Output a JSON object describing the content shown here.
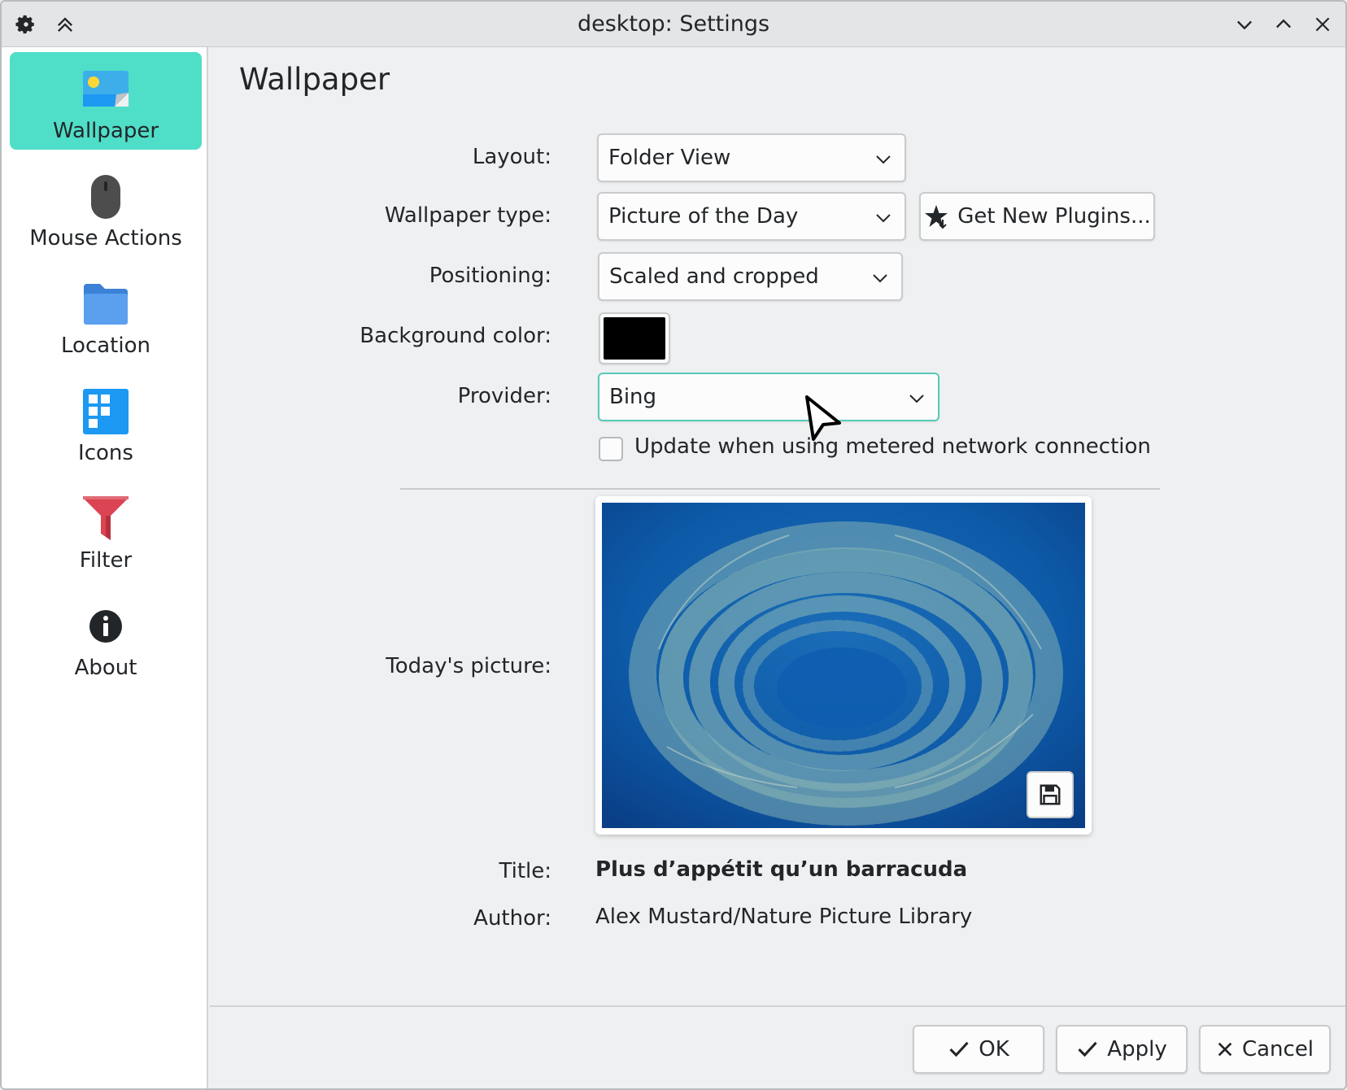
{
  "window": {
    "title": "desktop: Settings"
  },
  "sidebar": {
    "items": [
      {
        "label": "Wallpaper",
        "icon": "wallpaper-icon",
        "active": true
      },
      {
        "label": "Mouse Actions",
        "icon": "mouse-icon",
        "active": false
      },
      {
        "label": "Location",
        "icon": "folder-icon",
        "active": false
      },
      {
        "label": "Icons",
        "icon": "icons-grid-icon",
        "active": false
      },
      {
        "label": "Filter",
        "icon": "filter-icon",
        "active": false
      },
      {
        "label": "About",
        "icon": "info-icon",
        "active": false
      }
    ]
  },
  "main": {
    "page_title": "Wallpaper",
    "layout": {
      "label": "Layout:",
      "value": "Folder View"
    },
    "wallpaper_type": {
      "label": "Wallpaper type:",
      "value": "Picture of the Day"
    },
    "get_plugins_label": "Get New Plugins...",
    "positioning": {
      "label": "Positioning:",
      "value": "Scaled and cropped"
    },
    "background_color": {
      "label": "Background color:",
      "value": "#000000"
    },
    "provider": {
      "label": "Provider:",
      "value": "Bing"
    },
    "metered_checkbox": {
      "label": "Update when using metered network connection",
      "checked": false
    },
    "todays_picture_label": "Today's picture:",
    "title": {
      "label": "Title:",
      "value": "Plus d’appétit qu’un barracuda"
    },
    "author": {
      "label": "Author:",
      "value": "Alex Mustard/Nature Picture Library"
    }
  },
  "footer": {
    "ok_label": "OK",
    "apply_label": "Apply",
    "cancel_label": "Cancel"
  },
  "colors": {
    "accent": "#4fdec8",
    "background": "#eff0f1"
  }
}
